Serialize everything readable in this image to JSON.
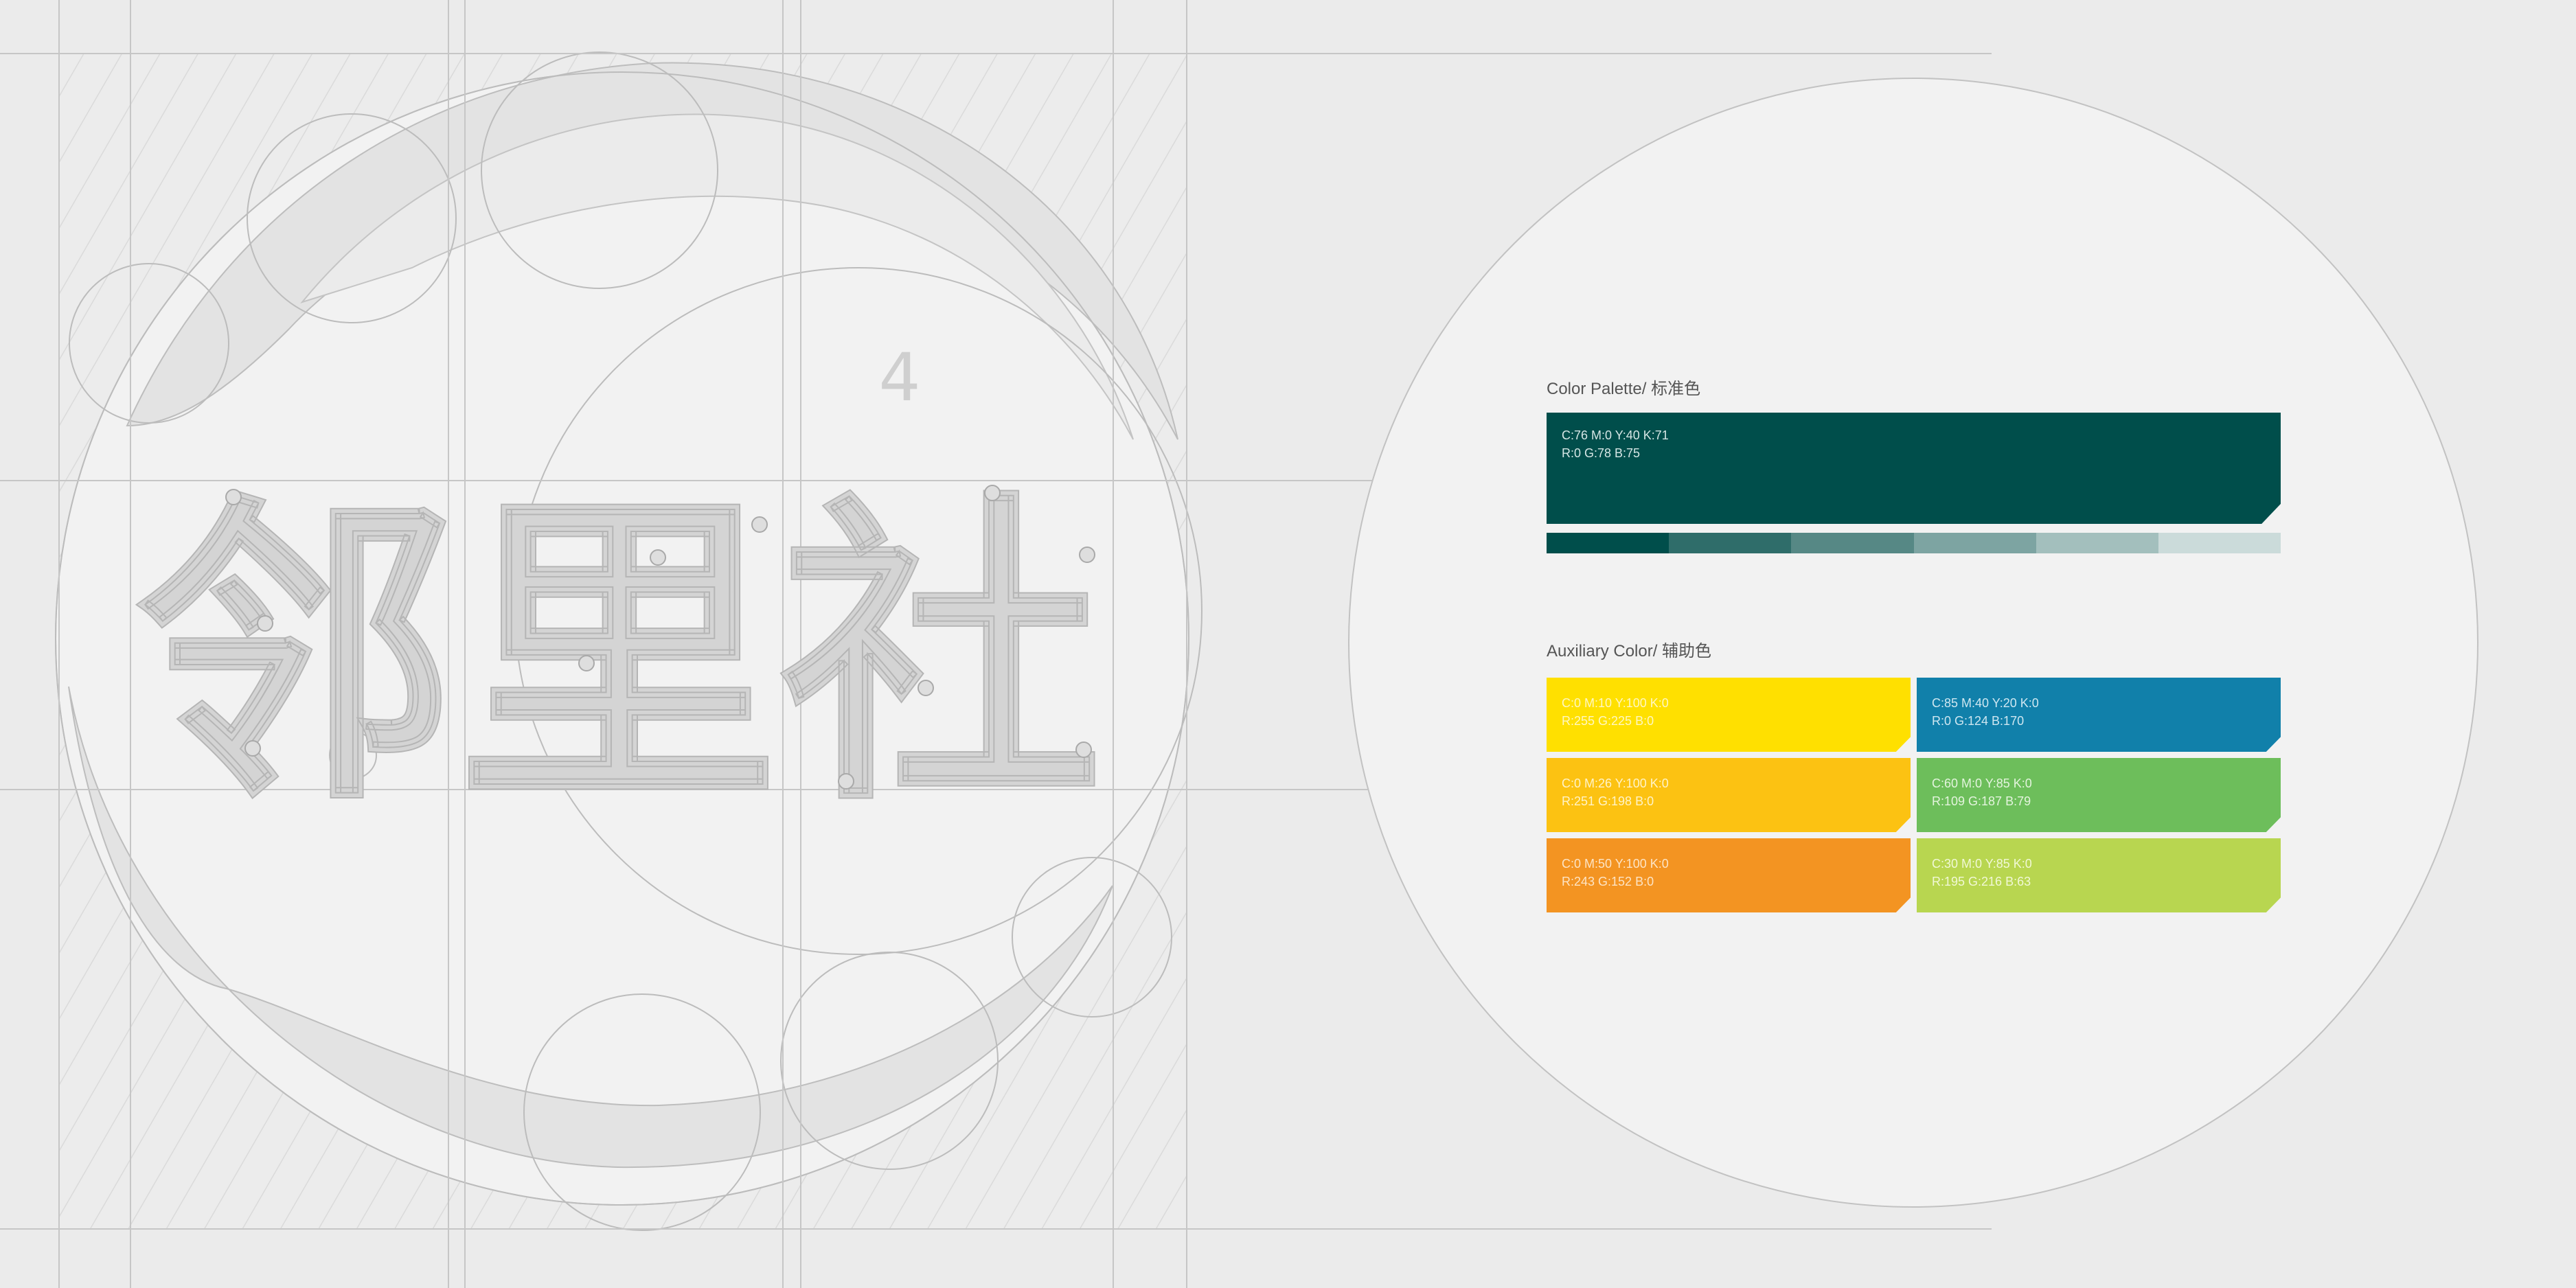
{
  "page": {
    "number": "4",
    "background": "#ebebeb"
  },
  "logo": {
    "wordmark": "邻里社",
    "construction_line_color": "#c2c2c2",
    "glyph_fill": "#d4d4d4"
  },
  "palette": {
    "title": "Color Palette/ 标准色",
    "primary": {
      "hex": "#004e4b",
      "cmyk": "C:76  M:0  Y:40  K:71",
      "rgb": "R:0  G:78  B:75",
      "text_color": "#d6e6e5"
    },
    "tint_steps": [
      "#004e4b",
      "#2f6d6a",
      "#568885",
      "#7da4a2",
      "#a3bfbd",
      "#cbdbda"
    ]
  },
  "auxiliary": {
    "title": "Auxiliary Color/  辅助色",
    "colors": [
      {
        "hex": "#ffe000",
        "cmyk": "C:0  M:10  Y:100  K:0",
        "rgb": "R:255  G:225  B:0",
        "text_color": "#fff7c2"
      },
      {
        "hex": "#1180aa",
        "cmyk": "C:85  M:40  Y:20  K:0",
        "rgb": "R:0  G:124  B:170",
        "text_color": "#cfe7f1"
      },
      {
        "hex": "#fcc212",
        "cmyk": "C:0  M:26  Y:100  K:0",
        "rgb": "R:251  G:198  B:0",
        "text_color": "#fff3c8"
      },
      {
        "hex": "#6dbe5b",
        "cmyk": "C:60  M:0  Y:85  K:0",
        "rgb": "R:109  G:187  B:79",
        "text_color": "#e4f4de"
      },
      {
        "hex": "#f39422",
        "cmyk": "C:0  M:50  Y:100  K:0",
        "rgb": "R:243  G:152  B:0",
        "text_color": "#fde4c5"
      },
      {
        "hex": "#b8d650",
        "cmyk": "C:30  M:0  Y:85  K:0",
        "rgb": "R:195  G:216  B:63",
        "text_color": "#f1f8d6"
      }
    ]
  }
}
